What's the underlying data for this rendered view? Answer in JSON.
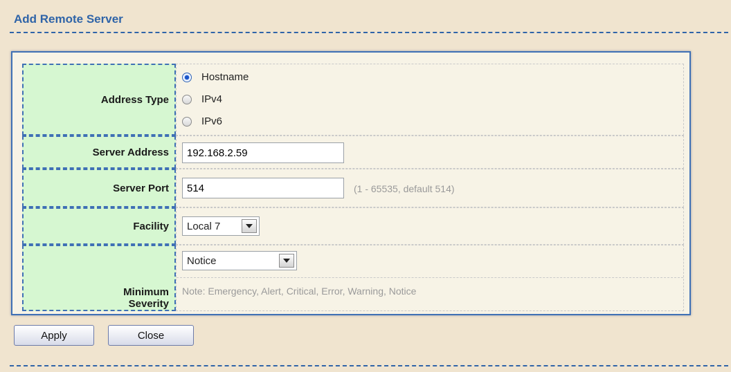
{
  "panel": {
    "title": "Add Remote Server"
  },
  "address_type": {
    "label": "Address Type",
    "options": [
      "Hostname",
      "IPv4",
      "IPv6"
    ],
    "selected": "Hostname"
  },
  "server_address": {
    "label": "Server Address",
    "value": "192.168.2.59"
  },
  "server_port": {
    "label": "Server Port",
    "value": "514",
    "hint": "(1 - 65535, default 514)"
  },
  "facility": {
    "label": "Facility",
    "selected": "Local 7"
  },
  "minimum_severity": {
    "label_line1": "Minimum",
    "label_line2": "Severity",
    "selected": "Notice",
    "note": "Note: Emergency, Alert, Critical, Error, Warning, Notice"
  },
  "buttons": {
    "apply": "Apply",
    "close": "Close"
  },
  "colors": {
    "accent": "#2f64a8",
    "label_bg": "#d6f7d1",
    "page_bg": "#f0e4cf"
  }
}
